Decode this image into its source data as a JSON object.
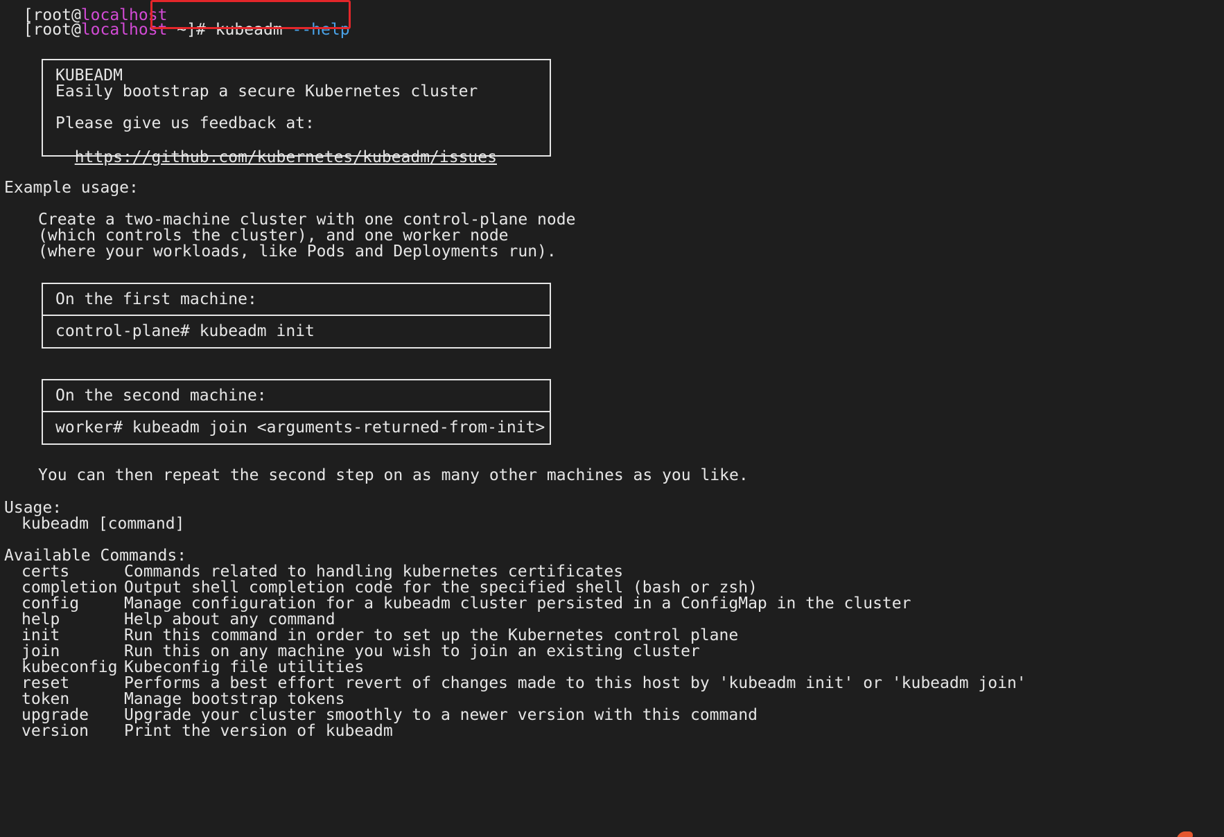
{
  "prompt": {
    "open_bracket": "[",
    "user": "root",
    "at": "@",
    "host": "localhost",
    "path": " ~",
    "close_bracket": "]",
    "hash": "# ",
    "command": "kubeadm ",
    "flag": "--help",
    "top_partial_user": "[root@",
    "top_partial_host": "localhost"
  },
  "banner": {
    "title": "KUBEADM",
    "subtitle": "Easily bootstrap a secure Kubernetes cluster",
    "feedback": "Please give us feedback at:",
    "url": "https://github.com/kubernetes/kubeadm/issues"
  },
  "example": {
    "heading": "Example usage:",
    "description_1": "Create a two-machine cluster with one control-plane node",
    "description_2": "(which controls the cluster), and one worker node",
    "description_3": "(where your workloads, like Pods and Deployments run).",
    "first_machine_label": "On the first machine:",
    "first_machine_cmd": "control-plane# kubeadm init",
    "second_machine_label": "On the second machine:",
    "second_machine_cmd": "worker# kubeadm join <arguments-returned-from-init>",
    "repeat_note": "You can then repeat the second step on as many other machines as you like."
  },
  "usage": {
    "heading": "Usage:",
    "syntax": "kubeadm [command]"
  },
  "commands": {
    "heading": "Available Commands:",
    "items": [
      {
        "name": "certs",
        "description": "Commands related to handling kubernetes certificates"
      },
      {
        "name": "completion",
        "description": "Output shell completion code for the specified shell (bash or zsh)"
      },
      {
        "name": "config",
        "description": "Manage configuration for a kubeadm cluster persisted in a ConfigMap in the cluster"
      },
      {
        "name": "help",
        "description": "Help about any command"
      },
      {
        "name": "init",
        "description": "Run this command in order to set up the Kubernetes control plane"
      },
      {
        "name": "join",
        "description": "Run this on any machine you wish to join an existing cluster"
      },
      {
        "name": "kubeconfig",
        "description": "Kubeconfig file utilities"
      },
      {
        "name": "reset",
        "description": "Performs a best effort revert of changes made to this host by 'kubeadm init' or 'kubeadm join'"
      },
      {
        "name": "token",
        "description": "Manage bootstrap tokens"
      },
      {
        "name": "upgrade",
        "description": "Upgrade your cluster smoothly to a newer version with this command"
      },
      {
        "name": "version",
        "description": "Print the version of kubeadm"
      }
    ]
  },
  "colors": {
    "background": "#1e1e1e",
    "text": "#e6e6e6",
    "host": "#d34bd6",
    "flag": "#4aa3e8",
    "highlight_border": "#e3262a"
  }
}
